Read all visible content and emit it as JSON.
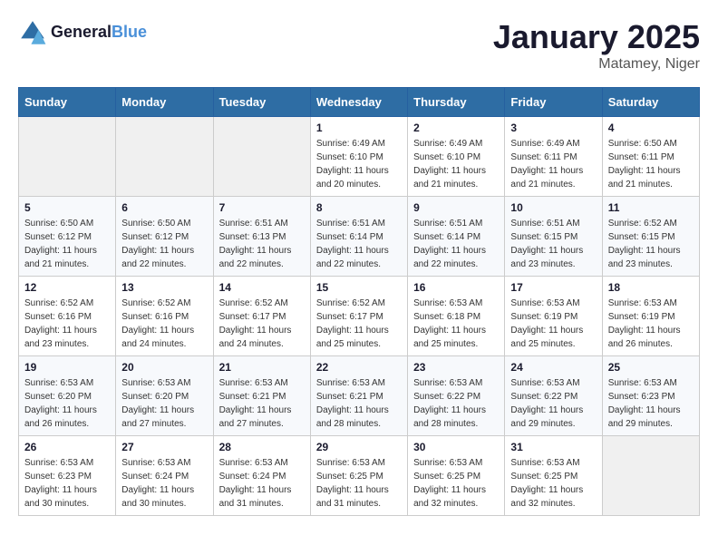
{
  "header": {
    "logo_line1": "General",
    "logo_line2": "Blue",
    "month": "January 2025",
    "location": "Matamey, Niger"
  },
  "weekdays": [
    "Sunday",
    "Monday",
    "Tuesday",
    "Wednesday",
    "Thursday",
    "Friday",
    "Saturday"
  ],
  "weeks": [
    [
      {
        "day": "",
        "info": ""
      },
      {
        "day": "",
        "info": ""
      },
      {
        "day": "",
        "info": ""
      },
      {
        "day": "1",
        "info": "Sunrise: 6:49 AM\nSunset: 6:10 PM\nDaylight: 11 hours\nand 20 minutes."
      },
      {
        "day": "2",
        "info": "Sunrise: 6:49 AM\nSunset: 6:10 PM\nDaylight: 11 hours\nand 21 minutes."
      },
      {
        "day": "3",
        "info": "Sunrise: 6:49 AM\nSunset: 6:11 PM\nDaylight: 11 hours\nand 21 minutes."
      },
      {
        "day": "4",
        "info": "Sunrise: 6:50 AM\nSunset: 6:11 PM\nDaylight: 11 hours\nand 21 minutes."
      }
    ],
    [
      {
        "day": "5",
        "info": "Sunrise: 6:50 AM\nSunset: 6:12 PM\nDaylight: 11 hours\nand 21 minutes."
      },
      {
        "day": "6",
        "info": "Sunrise: 6:50 AM\nSunset: 6:12 PM\nDaylight: 11 hours\nand 22 minutes."
      },
      {
        "day": "7",
        "info": "Sunrise: 6:51 AM\nSunset: 6:13 PM\nDaylight: 11 hours\nand 22 minutes."
      },
      {
        "day": "8",
        "info": "Sunrise: 6:51 AM\nSunset: 6:14 PM\nDaylight: 11 hours\nand 22 minutes."
      },
      {
        "day": "9",
        "info": "Sunrise: 6:51 AM\nSunset: 6:14 PM\nDaylight: 11 hours\nand 22 minutes."
      },
      {
        "day": "10",
        "info": "Sunrise: 6:51 AM\nSunset: 6:15 PM\nDaylight: 11 hours\nand 23 minutes."
      },
      {
        "day": "11",
        "info": "Sunrise: 6:52 AM\nSunset: 6:15 PM\nDaylight: 11 hours\nand 23 minutes."
      }
    ],
    [
      {
        "day": "12",
        "info": "Sunrise: 6:52 AM\nSunset: 6:16 PM\nDaylight: 11 hours\nand 23 minutes."
      },
      {
        "day": "13",
        "info": "Sunrise: 6:52 AM\nSunset: 6:16 PM\nDaylight: 11 hours\nand 24 minutes."
      },
      {
        "day": "14",
        "info": "Sunrise: 6:52 AM\nSunset: 6:17 PM\nDaylight: 11 hours\nand 24 minutes."
      },
      {
        "day": "15",
        "info": "Sunrise: 6:52 AM\nSunset: 6:17 PM\nDaylight: 11 hours\nand 25 minutes."
      },
      {
        "day": "16",
        "info": "Sunrise: 6:53 AM\nSunset: 6:18 PM\nDaylight: 11 hours\nand 25 minutes."
      },
      {
        "day": "17",
        "info": "Sunrise: 6:53 AM\nSunset: 6:19 PM\nDaylight: 11 hours\nand 25 minutes."
      },
      {
        "day": "18",
        "info": "Sunrise: 6:53 AM\nSunset: 6:19 PM\nDaylight: 11 hours\nand 26 minutes."
      }
    ],
    [
      {
        "day": "19",
        "info": "Sunrise: 6:53 AM\nSunset: 6:20 PM\nDaylight: 11 hours\nand 26 minutes."
      },
      {
        "day": "20",
        "info": "Sunrise: 6:53 AM\nSunset: 6:20 PM\nDaylight: 11 hours\nand 27 minutes."
      },
      {
        "day": "21",
        "info": "Sunrise: 6:53 AM\nSunset: 6:21 PM\nDaylight: 11 hours\nand 27 minutes."
      },
      {
        "day": "22",
        "info": "Sunrise: 6:53 AM\nSunset: 6:21 PM\nDaylight: 11 hours\nand 28 minutes."
      },
      {
        "day": "23",
        "info": "Sunrise: 6:53 AM\nSunset: 6:22 PM\nDaylight: 11 hours\nand 28 minutes."
      },
      {
        "day": "24",
        "info": "Sunrise: 6:53 AM\nSunset: 6:22 PM\nDaylight: 11 hours\nand 29 minutes."
      },
      {
        "day": "25",
        "info": "Sunrise: 6:53 AM\nSunset: 6:23 PM\nDaylight: 11 hours\nand 29 minutes."
      }
    ],
    [
      {
        "day": "26",
        "info": "Sunrise: 6:53 AM\nSunset: 6:23 PM\nDaylight: 11 hours\nand 30 minutes."
      },
      {
        "day": "27",
        "info": "Sunrise: 6:53 AM\nSunset: 6:24 PM\nDaylight: 11 hours\nand 30 minutes."
      },
      {
        "day": "28",
        "info": "Sunrise: 6:53 AM\nSunset: 6:24 PM\nDaylight: 11 hours\nand 31 minutes."
      },
      {
        "day": "29",
        "info": "Sunrise: 6:53 AM\nSunset: 6:25 PM\nDaylight: 11 hours\nand 31 minutes."
      },
      {
        "day": "30",
        "info": "Sunrise: 6:53 AM\nSunset: 6:25 PM\nDaylight: 11 hours\nand 32 minutes."
      },
      {
        "day": "31",
        "info": "Sunrise: 6:53 AM\nSunset: 6:25 PM\nDaylight: 11 hours\nand 32 minutes."
      },
      {
        "day": "",
        "info": ""
      }
    ]
  ]
}
